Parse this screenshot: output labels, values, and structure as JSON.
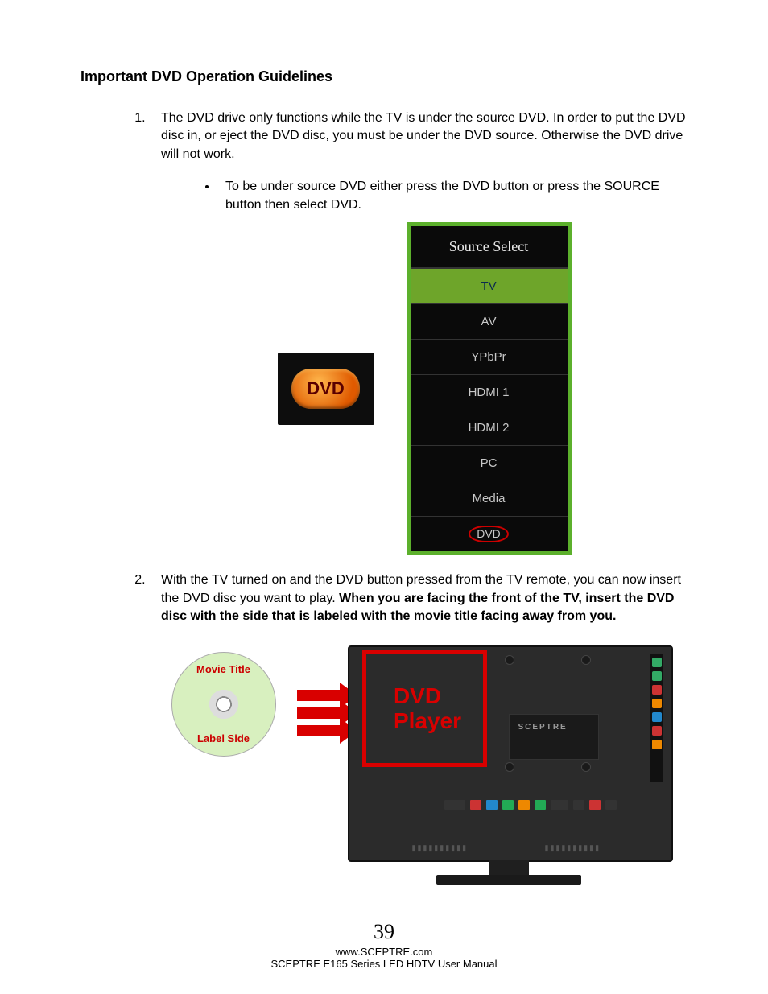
{
  "title": "Important DVD Operation Guidelines",
  "list": {
    "item1": "The DVD drive only functions while the TV is under the source DVD.  In order to put the DVD disc in, or eject the DVD disc, you must be under the DVD source. Otherwise the DVD drive will not work.",
    "sub1": "To be under source DVD either press the DVD button or press the SOURCE button then select DVD.",
    "item2a": "With the TV turned on and the DVD button pressed from the TV remote, you can now insert the DVD disc you want to play.  ",
    "item2b": "When you are facing the front of the TV, insert the DVD disc with the side that is labeled with the movie title facing away from you."
  },
  "dvd_button_label": "DVD",
  "menu": {
    "header": "Source Select",
    "items": [
      "TV",
      "AV",
      "YPbPr",
      "HDMI 1",
      "HDMI 2",
      "PC",
      "Media",
      "DVD"
    ],
    "selected": "TV",
    "circled": "DVD"
  },
  "disc": {
    "top": "Movie Title",
    "bottom": "Label Side"
  },
  "tv_slot_label": "DVD Player",
  "tv_brand": "SCEPTRE",
  "footer": {
    "page": "39",
    "url": "www.SCEPTRE.com",
    "manual": "SCEPTRE E165 Series LED HDTV User Manual"
  }
}
